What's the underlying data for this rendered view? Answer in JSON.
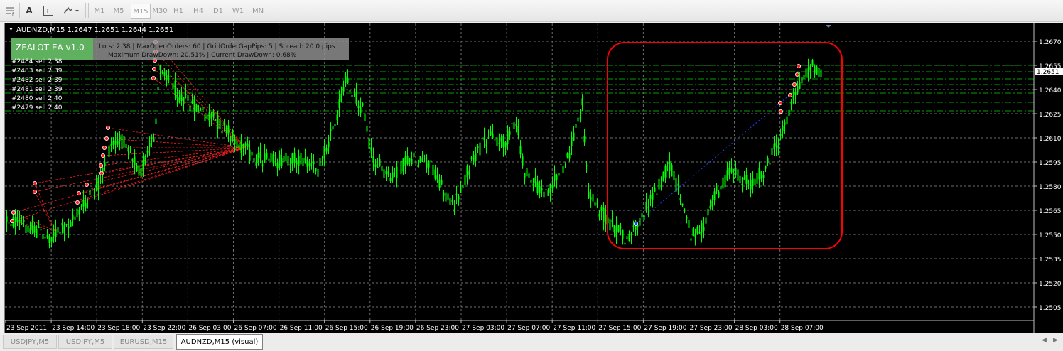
{
  "toolbar": {
    "timeframes": [
      "M1",
      "M5",
      "M15",
      "M30",
      "H1",
      "H4",
      "D1",
      "W1",
      "MN"
    ],
    "active_timeframe": "M15",
    "icons": [
      "grid-lines-icon",
      "text-A-icon",
      "text-box-icon",
      "draw-objects-icon"
    ]
  },
  "chart": {
    "header": "AUDNZD,M15  1.2647 1.2651 1.2644 1.2651",
    "ea_name": "ZEALOT EA v1.0",
    "info_line1": "Lots: 2.38   |   MaxOpenOrders: 60   |   GridOrderGapPips: 5   |   Spread: 20.0 pips",
    "info_line2": "Maximum DrawDown: 20.51%      |      Current DrawDown: 0.68%",
    "orders": [
      "#2484 sell 2.38",
      "#2483 sell 2.39",
      "#2482 sell 2.39",
      "#2481 sell 2.39",
      "#2480 sell 2.40",
      "#2479 sell 2.40"
    ],
    "price_labels": [
      "1.2670",
      "1.2655",
      "1.2640",
      "1.2625",
      "1.2610",
      "1.2595",
      "1.2580",
      "1.2565",
      "1.2550",
      "1.2535",
      "1.2520",
      "1.2505"
    ],
    "current_price": "1.2651",
    "time_labels": [
      "23 Sep 2011",
      "23 Sep 14:00",
      "23 Sep 18:00",
      "23 Sep 22:00",
      "26 Sep 03:00",
      "26 Sep 07:00",
      "26 Sep 11:00",
      "26 Sep 15:00",
      "26 Sep 19:00",
      "26 Sep 23:00",
      "27 Sep 03:00",
      "27 Sep 07:00",
      "27 Sep 11:00",
      "27 Sep 15:00",
      "27 Sep 19:00",
      "27 Sep 23:00",
      "28 Sep 03:00",
      "28 Sep 07:00"
    ],
    "colors": {
      "background": "#000000",
      "candles": "#00ff00",
      "grid": "#6e6e6e",
      "order_lines": "#00a000",
      "highlight": "#ff0000",
      "info_panel": "#9a9a9a",
      "ea_badge": "#5fb15f"
    }
  },
  "tabs": [
    {
      "label": "USDJPY,M5",
      "active": false
    },
    {
      "label": "USDJPY,M5",
      "active": false
    },
    {
      "label": "EURUSD,M15",
      "active": false
    },
    {
      "label": "AUDNZD,M15 (visual)",
      "active": true
    }
  ]
}
